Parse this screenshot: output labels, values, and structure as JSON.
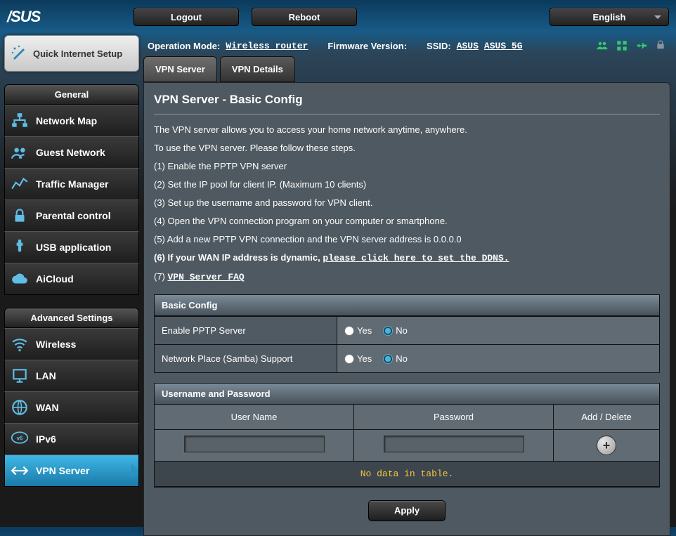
{
  "brand": "/SUS",
  "topbar": {
    "logout": "Logout",
    "reboot": "Reboot",
    "language": "English"
  },
  "info": {
    "op_mode_label": "Operation Mode:",
    "op_mode_value": "Wireless router",
    "fw_label": "Firmware Version:",
    "ssid_label": "SSID:",
    "ssid1": "ASUS",
    "ssid2": "ASUS_5G"
  },
  "quick_setup": "Quick Internet Setup",
  "section_general": "General",
  "section_advanced": "Advanced Settings",
  "general_items": [
    "Network Map",
    "Guest Network",
    "Traffic Manager",
    "Parental control",
    "USB application",
    "AiCloud"
  ],
  "advanced_items": [
    "Wireless",
    "LAN",
    "WAN",
    "IPv6",
    "VPN Server"
  ],
  "tabs": {
    "server": "VPN Server",
    "details": "VPN Details"
  },
  "page_title": "VPN Server - Basic Config",
  "desc": {
    "intro": "The VPN server allows you to access your home network anytime, anywhere.",
    "follow": "To use the VPN server. Please follow these steps.",
    "s1": "(1) Enable the PPTP VPN server",
    "s2": "(2) Set the IP pool for client IP. (Maximum 10 clients)",
    "s3": "(3) Set up the username and password for VPN client.",
    "s4": "(4) Open the VPN connection program on your computer or smartphone.",
    "s5": "(5) Add a new PPTP VPN connection and the VPN server address is 0.0.0.0",
    "s6a": "(6) If your WAN IP address is dynamic, ",
    "s6link": "please click here to set the DDNS.",
    "s7a": "(7) ",
    "s7link": "VPN Server FAQ"
  },
  "basic_config": {
    "header": "Basic Config",
    "row1_label": "Enable PPTP Server",
    "row2_label": "Network Place (Samba) Support",
    "yes": "Yes",
    "no": "No",
    "row1_selected": "no",
    "row2_selected": "no"
  },
  "userpass": {
    "header": "Username and Password",
    "col_user": "User Name",
    "col_pass": "Password",
    "col_ad": "Add / Delete",
    "no_data": "No data in table."
  },
  "apply": "Apply"
}
